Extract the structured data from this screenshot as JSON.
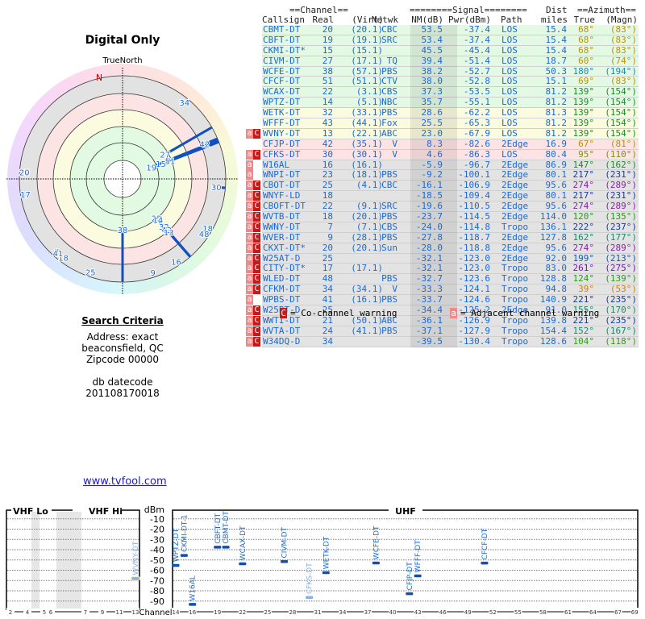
{
  "radar": {
    "title": "Digital Only",
    "north_label": "TrueNorth",
    "n_marker": "N"
  },
  "search": {
    "heading": "Search Criteria",
    "address": "Address: exact",
    "city": "beaconsfield, QC",
    "zipcode": "Zipcode 00000",
    "db_label": "db datecode",
    "db_value": "201108170018"
  },
  "link": "www.tvfool.com",
  "table": {
    "group_channel": "==Channel==",
    "group_signal": "========Signal========",
    "group_dist": "Dist",
    "group_azimuth": "==Azimuth==",
    "columns": [
      "Callsign",
      "Real",
      "(Virt)",
      "Netwk",
      "NM(dB)",
      "Pwr(dBm)",
      "Path",
      "miles",
      "True",
      "(Magn)"
    ],
    "rows": [
      {
        "call": "CBMT-DT",
        "real": "20",
        "virt": "(20.1)",
        "net": "CBC",
        "nm": "53.5",
        "pwr": "-37.4",
        "path": "LOS",
        "dist": "15.4",
        "true": "68°",
        "magn": "(83°)",
        "warn": "",
        "band": "green",
        "az_color": "#b8920a"
      },
      {
        "call": "CBFT-DT",
        "real": "19",
        "virt": "(19.1)",
        "net": "SRC",
        "nm": "53.4",
        "pwr": "-37.4",
        "path": "LOS",
        "dist": "15.4",
        "true": "68°",
        "magn": "(83°)",
        "warn": "",
        "band": "green",
        "az_color": "#b8920a"
      },
      {
        "call": "CKMI-DT*",
        "real": "15",
        "virt": "(15.1)",
        "net": "",
        "nm": "45.5",
        "pwr": "-45.4",
        "path": "LOS",
        "dist": "15.4",
        "true": "68°",
        "magn": "(83°)",
        "warn": "",
        "band": "green",
        "az_color": "#b8920a"
      },
      {
        "call": "CIVM-DT",
        "real": "27",
        "virt": "(17.1)",
        "net": "TQ",
        "nm": "39.4",
        "pwr": "-51.4",
        "path": "LOS",
        "dist": "18.7",
        "true": "60°",
        "magn": "(74°)",
        "warn": "",
        "band": "green",
        "az_color": "#b8920a"
      },
      {
        "call": "WCFE-DT",
        "real": "38",
        "virt": "(57.1)",
        "net": "PBS",
        "nm": "38.2",
        "pwr": "-52.7",
        "path": "LOS",
        "dist": "50.3",
        "true": "180°",
        "magn": "(194°)",
        "warn": "",
        "band": "green",
        "az_color": "#1a8aa8"
      },
      {
        "call": "CFCF-DT",
        "real": "51",
        "virt": "(51.1)",
        "net": "CTV",
        "nm": "38.0",
        "pwr": "-52.8",
        "path": "LOS",
        "dist": "15.1",
        "true": "69°",
        "magn": "(83°)",
        "warn": "",
        "band": "green",
        "az_color": "#b8920a"
      },
      {
        "call": "WCAX-DT",
        "real": "22",
        "virt": "(3.1)",
        "net": "CBS",
        "nm": "37.3",
        "pwr": "-53.5",
        "path": "LOS",
        "dist": "81.2",
        "true": "139°",
        "magn": "(154°)",
        "warn": "",
        "band": "green",
        "az_color": "#1e8a2e"
      },
      {
        "call": "WPTZ-DT",
        "real": "14",
        "virt": "(5.1)",
        "net": "NBC",
        "nm": "35.7",
        "pwr": "-55.1",
        "path": "LOS",
        "dist": "81.2",
        "true": "139°",
        "magn": "(154°)",
        "warn": "",
        "band": "green",
        "az_color": "#1e8a2e"
      },
      {
        "call": "WETK-DT",
        "real": "32",
        "virt": "(33.1)",
        "net": "PBS",
        "nm": "28.6",
        "pwr": "-62.2",
        "path": "LOS",
        "dist": "81.3",
        "true": "139°",
        "magn": "(154°)",
        "warn": "",
        "band": "yellow",
        "az_color": "#1e8a2e"
      },
      {
        "call": "WFFF-DT",
        "real": "43",
        "virt": "(44.1)",
        "net": "Fox",
        "nm": "25.5",
        "pwr": "-65.3",
        "path": "LOS",
        "dist": "81.2",
        "true": "139°",
        "magn": "(154°)",
        "warn": "",
        "band": "yellow",
        "az_color": "#1e8a2e"
      },
      {
        "call": "WVNY-DT",
        "real": "13",
        "virt": "(22.1)",
        "net": "ABC",
        "nm": "23.0",
        "pwr": "-67.9",
        "path": "LOS",
        "dist": "81.2",
        "true": "139°",
        "magn": "(154°)",
        "warn": "aC",
        "band": "yellow",
        "az_color": "#1e8a2e"
      },
      {
        "call": "CFJP-DT",
        "real": "42",
        "virt": "(35.1)",
        "net": "V",
        "nm": "8.3",
        "pwr": "-82.6",
        "path": "2Edge",
        "dist": "16.9",
        "true": "67°",
        "magn": "(81°)",
        "warn": "",
        "band": "pink",
        "az_color": "#b8920a"
      },
      {
        "call": "CFKS-DT",
        "real": "30",
        "virt": "(30.1)",
        "net": "V",
        "nm": "4.6",
        "pwr": "-86.3",
        "path": "LOS",
        "dist": "80.4",
        "true": "95°",
        "magn": "(110°)",
        "warn": "aC",
        "band": "pink",
        "az_color": "#6a9a10"
      },
      {
        "call": "W16AL",
        "real": "16",
        "virt": "(16.1)",
        "net": "",
        "nm": "-5.9",
        "pwr": "-96.7",
        "path": "2Edge",
        "dist": "86.9",
        "true": "147°",
        "magn": "(162°)",
        "warn": "a",
        "band": "gray",
        "az_color": "#1e8a2e"
      },
      {
        "call": "WNPI-DT",
        "real": "23",
        "virt": "(18.1)",
        "net": "PBS",
        "nm": "-9.2",
        "pwr": "-100.1",
        "path": "2Edge",
        "dist": "80.1",
        "true": "217°",
        "magn": "(231°)",
        "warn": "a",
        "band": "gray",
        "az_color": "#1a3a9a"
      },
      {
        "call": "CBOT-DT",
        "real": "25",
        "virt": "(4.1)",
        "net": "CBC",
        "nm": "-16.1",
        "pwr": "-106.9",
        "path": "2Edge",
        "dist": "95.6",
        "true": "274°",
        "magn": "(289°)",
        "warn": "aC",
        "band": "gray",
        "az_color": "#8a1ab0"
      },
      {
        "call": "WNYF-LD",
        "real": "18",
        "virt": "",
        "net": "",
        "nm": "-18.5",
        "pwr": "-109.4",
        "path": "2Edge",
        "dist": "80.1",
        "true": "217°",
        "magn": "(231°)",
        "warn": "aC",
        "band": "gray",
        "az_color": "#1a3a9a"
      },
      {
        "call": "CBOFT-DT",
        "real": "22",
        "virt": "(9.1)",
        "net": "SRC",
        "nm": "-19.6",
        "pwr": "-110.5",
        "path": "2Edge",
        "dist": "95.6",
        "true": "274°",
        "magn": "(289°)",
        "warn": "aC",
        "band": "gray",
        "az_color": "#8a1ab0"
      },
      {
        "call": "WVTB-DT",
        "real": "18",
        "virt": "(20.1)",
        "net": "PBS",
        "nm": "-23.7",
        "pwr": "-114.5",
        "path": "2Edge",
        "dist": "114.0",
        "true": "120°",
        "magn": "(135°)",
        "warn": "aC",
        "band": "gray",
        "az_color": "#2a9a1a"
      },
      {
        "call": "WWNY-DT",
        "real": "7",
        "virt": "(7.1)",
        "net": "CBS",
        "nm": "-24.0",
        "pwr": "-114.8",
        "path": "Tropo",
        "dist": "136.1",
        "true": "222°",
        "magn": "(237°)",
        "warn": "aC",
        "band": "gray",
        "az_color": "#1a3a9a"
      },
      {
        "call": "WVER-DT",
        "real": "9",
        "virt": "(28.1)",
        "net": "PBS",
        "nm": "-27.8",
        "pwr": "-118.7",
        "path": "2Edge",
        "dist": "127.8",
        "true": "162°",
        "magn": "(177°)",
        "warn": "aC",
        "band": "gray",
        "az_color": "#1a8a6a"
      },
      {
        "call": "CKXT-DT*",
        "real": "20",
        "virt": "(20.1)",
        "net": "Sun",
        "nm": "-28.0",
        "pwr": "-118.8",
        "path": "2Edge",
        "dist": "95.6",
        "true": "274°",
        "magn": "(289°)",
        "warn": "aC",
        "band": "gray",
        "az_color": "#8a1ab0"
      },
      {
        "call": "W25AT-D",
        "real": "25",
        "virt": "",
        "net": "",
        "nm": "-32.1",
        "pwr": "-123.0",
        "path": "2Edge",
        "dist": "92.0",
        "true": "199°",
        "magn": "(213°)",
        "warn": "aC",
        "band": "gray",
        "az_color": "#1a5aaa"
      },
      {
        "call": "CITY-DT*",
        "real": "17",
        "virt": "(17.1)",
        "net": "",
        "nm": "-32.1",
        "pwr": "-123.0",
        "path": "Tropo",
        "dist": "83.0",
        "true": "261°",
        "magn": "(275°)",
        "warn": "aC",
        "band": "gray",
        "az_color": "#6a1ab0"
      },
      {
        "call": "WLED-DT",
        "real": "48",
        "virt": "",
        "net": "PBS",
        "nm": "-32.7",
        "pwr": "-123.6",
        "path": "Tropo",
        "dist": "128.8",
        "true": "124°",
        "magn": "(139°)",
        "warn": "aC",
        "band": "gray",
        "az_color": "#2a9a1a"
      },
      {
        "call": "CFKM-DT",
        "real": "34",
        "virt": "(34.1)",
        "net": "V",
        "nm": "-33.3",
        "pwr": "-124.1",
        "path": "Tropo",
        "dist": "94.8",
        "true": "39°",
        "magn": "(53°)",
        "warn": "aC",
        "band": "gray",
        "az_color": "#d08010"
      },
      {
        "call": "WPBS-DT",
        "real": "41",
        "virt": "(16.1)",
        "net": "PBS",
        "nm": "-33.7",
        "pwr": "-124.6",
        "path": "Tropo",
        "dist": "140.9",
        "true": "221°",
        "magn": "(235°)",
        "warn": "a",
        "band": "gray",
        "az_color": "#1a3a9a"
      },
      {
        "call": "W25BT-D",
        "real": "25",
        "virt": "",
        "net": "",
        "nm": "-34.4",
        "pwr": "-125.2",
        "path": "2Edge",
        "dist": "91.0",
        "true": "155°",
        "magn": "(170°)",
        "warn": "aC",
        "band": "gray",
        "az_color": "#1a8a6a"
      },
      {
        "call": "WWTI-DT",
        "real": "21",
        "virt": "(50.1)",
        "net": "ABC",
        "nm": "-36.1",
        "pwr": "-126.9",
        "path": "Tropo",
        "dist": "139.8",
        "true": "221°",
        "magn": "(235°)",
        "warn": "aC",
        "band": "gray",
        "az_color": "#1a3a9a"
      },
      {
        "call": "WVTA-DT",
        "real": "24",
        "virt": "(41.1)",
        "net": "PBS",
        "nm": "-37.1",
        "pwr": "-127.9",
        "path": "Tropo",
        "dist": "154.4",
        "true": "152°",
        "magn": "(167°)",
        "warn": "aC",
        "band": "gray",
        "az_color": "#1a8a6a"
      },
      {
        "call": "W34DQ-D",
        "real": "34",
        "virt": "",
        "net": "",
        "nm": "-39.5",
        "pwr": "-130.4",
        "path": "Tropo",
        "dist": "128.6",
        "true": "104°",
        "magn": "(118°)",
        "warn": "aC",
        "band": "gray",
        "az_color": "#3a9a1a"
      }
    ],
    "band_colors": {
      "green": "#e4f9e4",
      "yellow": "#fbfbdf",
      "pink": "#fde3e3",
      "gray": "#e3e3e3"
    },
    "legend_co": "= Co-channel warning",
    "legend_adj": "= Adjacent channel warning",
    "legend_co_glyph": "C",
    "legend_adj_glyph": "a"
  },
  "spectrum": {
    "vhf_lo": "VHF Lo",
    "vhf_hi": "VHF Hi",
    "uhf": "UHF",
    "y_unit": "dBm",
    "x_label": "Channel",
    "y_ticks": [
      -10,
      -20,
      -30,
      -40,
      -50,
      -60,
      -70,
      -80,
      -90
    ],
    "vhf_ticks": [
      2,
      4,
      5,
      6,
      7,
      9,
      11,
      13
    ],
    "uhf_ticks": [
      14,
      16,
      19,
      22,
      25,
      28,
      31,
      34,
      37,
      40,
      43,
      46,
      49,
      52,
      55,
      58,
      61,
      64,
      67,
      69
    ],
    "stations": [
      {
        "label": "WPTZ-DT",
        "ch": 14,
        "dbm": -55.1,
        "weak": false
      },
      {
        "label": "CKMI-DT-1",
        "ch": 15,
        "dbm": -45.4,
        "weak": false
      },
      {
        "label": "W16AL",
        "ch": 16,
        "dbm": -96.7,
        "weak": false
      },
      {
        "label": "CBFT-DT",
        "ch": 19,
        "dbm": -37.4,
        "weak": false
      },
      {
        "label": "CBMT-DT",
        "ch": 20,
        "dbm": -37.4,
        "weak": false
      },
      {
        "label": "WCAX-DT",
        "ch": 22,
        "dbm": -53.5,
        "weak": false
      },
      {
        "label": "CIVM-DT",
        "ch": 27,
        "dbm": -51.4,
        "weak": false
      },
      {
        "label": "CFKS-DT",
        "ch": 30,
        "dbm": -86.3,
        "weak": true
      },
      {
        "label": "WETK-DT",
        "ch": 32,
        "dbm": -62.2,
        "weak": false
      },
      {
        "label": "WCFE-DT",
        "ch": 38,
        "dbm": -52.7,
        "weak": false
      },
      {
        "label": "CFJP-DT",
        "ch": 42,
        "dbm": -82.6,
        "weak": false
      },
      {
        "label": "WFFF-DT",
        "ch": 43,
        "dbm": -65.3,
        "weak": false
      },
      {
        "label": "CFCF-DT",
        "ch": 51,
        "dbm": -52.8,
        "weak": false
      },
      {
        "label": "WVNY-DT",
        "ch": 13,
        "dbm": -67.9,
        "weak": true
      }
    ]
  }
}
